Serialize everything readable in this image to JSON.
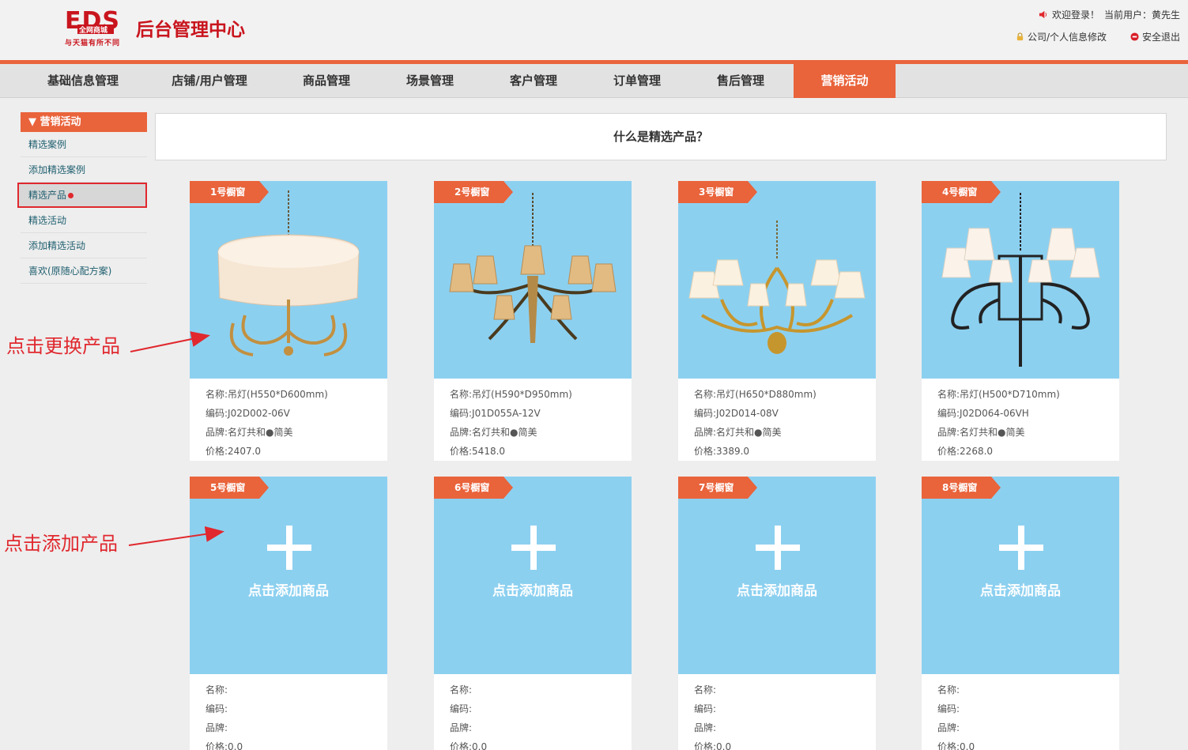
{
  "header": {
    "logo_mark": "EDS",
    "logo_sub": "全网商城",
    "logo_slogan": "与天猫有所不同",
    "logo_title": "后台管理中心",
    "welcome": "欢迎登录！",
    "current_user_label": "当前用户：",
    "current_user": "黄先生",
    "profile_link": "公司/个人信息修改",
    "logout_link": "安全退出"
  },
  "nav": {
    "items": [
      {
        "label": "基础信息管理"
      },
      {
        "label": "店铺/用户管理"
      },
      {
        "label": "商品管理"
      },
      {
        "label": "场景管理"
      },
      {
        "label": "客户管理"
      },
      {
        "label": "订单管理"
      },
      {
        "label": "售后管理"
      },
      {
        "label": "营销活动"
      }
    ],
    "active_index": 7
  },
  "sidebar": {
    "title": "▼ 营销活动",
    "items": [
      {
        "label": "精选案例"
      },
      {
        "label": "添加精选案例"
      },
      {
        "label": "精选产品"
      },
      {
        "label": "精选活动"
      },
      {
        "label": "添加精选活动"
      },
      {
        "label": "喜欢(原随心配方案)"
      }
    ],
    "selected_index": 2
  },
  "main": {
    "question": "什么是精选产品？",
    "add_text": "点击添加商品",
    "labels": {
      "name": "名称:",
      "code": "编码:",
      "brand": "品牌:",
      "price": "价格:"
    },
    "cards": [
      {
        "tag": "1号橱窗",
        "name": "吊灯(H550*D600mm)",
        "code": "J02D002-06V",
        "brand": "名灯共和●简美",
        "price": "2407.0",
        "lamp": "drum"
      },
      {
        "tag": "2号橱窗",
        "name": "吊灯(H590*D950mm)",
        "code": "J01D055A-12V",
        "brand": "名灯共和●简美",
        "price": "5418.0",
        "lamp": "bronze"
      },
      {
        "tag": "3号橱窗",
        "name": "吊灯(H650*D880mm)",
        "code": "J02D014-08V",
        "brand": "名灯共和●简美",
        "price": "3389.0",
        "lamp": "gold"
      },
      {
        "tag": "4号橱窗",
        "name": "吊灯(H500*D710mm)",
        "code": "J02D064-06VH",
        "brand": "名灯共和●简美",
        "price": "2268.0",
        "lamp": "black"
      },
      {
        "tag": "5号橱窗",
        "name": "",
        "code": "",
        "brand": "",
        "price": "0.0",
        "lamp": "empty"
      },
      {
        "tag": "6号橱窗",
        "name": "",
        "code": "",
        "brand": "",
        "price": "0.0",
        "lamp": "empty"
      },
      {
        "tag": "7号橱窗",
        "name": "",
        "code": "",
        "brand": "",
        "price": "0.0",
        "lamp": "empty"
      },
      {
        "tag": "8号橱窗",
        "name": "",
        "code": "",
        "brand": "",
        "price": "0.0",
        "lamp": "empty"
      }
    ]
  },
  "annotations": {
    "replace": "点击更换产品",
    "add": "点击添加产品"
  },
  "colors": {
    "accent": "#e9633b",
    "card_bg": "#8cd0f0",
    "annotation": "#e0282e",
    "sidebar_link": "#1f5f6f"
  }
}
